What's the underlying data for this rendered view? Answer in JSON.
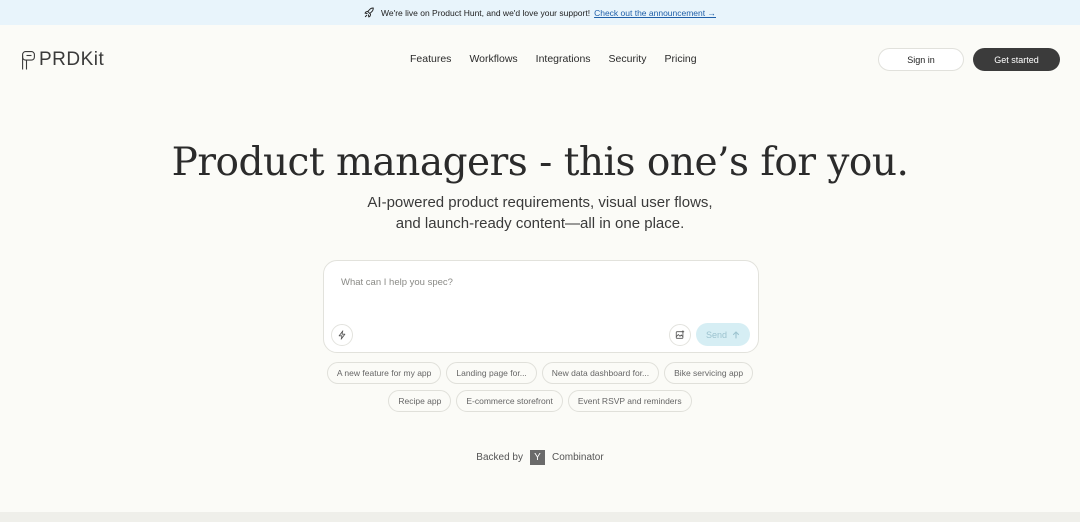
{
  "announcement": {
    "text": "We're live on Product Hunt, and we'd love your support!",
    "link": "Check out the announcement →"
  },
  "brand": {
    "name": "PRDKit"
  },
  "nav": {
    "links": [
      "Features",
      "Workflows",
      "Integrations",
      "Security",
      "Pricing"
    ],
    "signin": "Sign in",
    "get_started": "Get started"
  },
  "hero": {
    "title": "Product managers - this one’s for you.",
    "subtitle_line1": "AI-powered product requirements, visual user flows,",
    "subtitle_line2": "and launch-ready content—all in one place."
  },
  "prompt": {
    "placeholder": "What can I help you spec?",
    "send_label": "Send"
  },
  "suggestions": {
    "row1": [
      "A new feature for my app",
      "Landing page for...",
      "New data dashboard for...",
      "Bike servicing app"
    ],
    "row2": [
      "Recipe app",
      "E-commerce storefront",
      "Event RSVP and reminders"
    ]
  },
  "backed": {
    "prefix": "Backed by",
    "yc_mark": "Y",
    "suffix": "Combinator"
  },
  "colors": {
    "announcement_bg": "#e8f4fb",
    "link": "#1f5fa8",
    "primary_button": "#3b3b3b",
    "send_button": "#d6eef4",
    "page_bg": "#fbfbf7"
  },
  "icons": {
    "announcement": "rocket-icon",
    "logo": "prdkit-logo-mark",
    "enhance": "lightning-icon",
    "attach": "image-add-icon",
    "send": "arrow-up-icon"
  }
}
